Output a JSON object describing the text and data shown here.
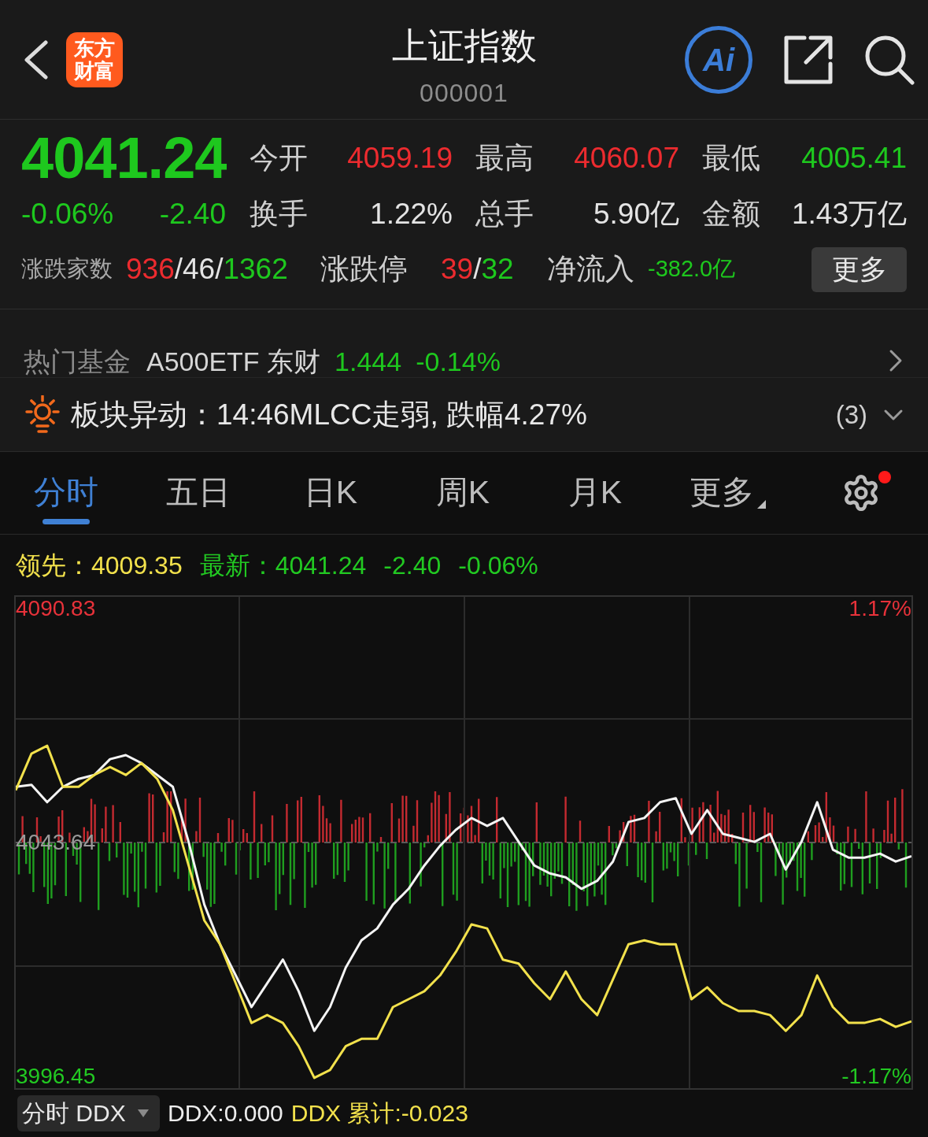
{
  "header": {
    "logo": "东方财富",
    "title": "上证指数",
    "code": "000001",
    "ai_label": "Ai"
  },
  "quote": {
    "price": "4041.24",
    "color": "#1ec81e",
    "change_pct": "-0.06%",
    "change": "-2.40",
    "stats": [
      {
        "label": "今开",
        "value": "4059.19",
        "color": "#ec2b2f"
      },
      {
        "label": "最高",
        "value": "4060.07",
        "color": "#ec2b2f"
      },
      {
        "label": "最低",
        "value": "4005.41",
        "color": "#1ec81e"
      },
      {
        "label": "换手",
        "value": "1.22%",
        "color": "#e4e4e4"
      },
      {
        "label": "总手",
        "value": "5.90亿",
        "color": "#e4e4e4"
      },
      {
        "label": "金额",
        "value": "1.43万亿",
        "color": "#e4e4e4"
      }
    ],
    "breadth": {
      "label": "涨跌家数",
      "parts": [
        {
          "text": "936",
          "color": "#ec2b2f"
        },
        {
          "text": "/46/",
          "color": "#e4e4e4"
        },
        {
          "text": "1362",
          "color": "#1ec81e"
        }
      ]
    },
    "limits": {
      "label": "涨跌停",
      "parts": [
        {
          "text": "39",
          "color": "#ec2b2f"
        },
        {
          "text": "/",
          "color": "#e4e4e4"
        },
        {
          "text": "32",
          "color": "#1ec81e"
        }
      ]
    },
    "net_inflow": {
      "label": "净流入",
      "value": "-382.0亿",
      "color": "#1ec81e"
    },
    "more_button": "更多"
  },
  "hot_fund": {
    "label": "热门基金",
    "name": "A500ETF 东财",
    "price": "1.444",
    "change": "-0.14%",
    "color": "#1ec81e"
  },
  "sector_alert": {
    "text": "板块异动：14:46MLCC走弱, 跌幅4.27%",
    "count": "(3)"
  },
  "tabs": [
    {
      "label": "分时",
      "selected": true,
      "kind": "tab"
    },
    {
      "label": "五日",
      "selected": false,
      "kind": "tab"
    },
    {
      "label": "日K",
      "selected": false,
      "kind": "tab"
    },
    {
      "label": "周K",
      "selected": false,
      "kind": "tab"
    },
    {
      "label": "月K",
      "selected": false,
      "kind": "tab"
    },
    {
      "label": "更多",
      "selected": false,
      "kind": "menu"
    }
  ],
  "settings": {
    "notification": true
  },
  "legend": [
    {
      "label": "领先：",
      "values": [
        "4009.35"
      ],
      "color": "#f2e14c"
    },
    {
      "label": "最新：",
      "values": [
        "4041.24",
        "-2.40",
        "-0.06%"
      ],
      "color": "#22c922"
    }
  ],
  "chart": {
    "chart_data": {
      "type": "line",
      "ylim": [
        3993.7,
        4093.6
      ],
      "yticks": [
        {
          "value": 4090.83,
          "label": "4090.83"
        },
        {
          "value": 4043.64,
          "label": "4043.64"
        },
        {
          "value": 3996.45,
          "label": "3996.45"
        }
      ],
      "series": [
        {
          "color": "#f4f4f4",
          "values": [
            4054.9,
            4055.3,
            4051.8,
            4054.9,
            4056.5,
            4057.3,
            4060.5,
            4061.3,
            4059.7,
            4057.3,
            4054.9,
            4043.8,
            4031.1,
            4023.1,
            4016.8,
            4010.4,
            4015.2,
            4020.0,
            4013.6,
            4005.6,
            4010.4,
            4018.4,
            4023.9,
            4026.3,
            4031.1,
            4034.3,
            4039.0,
            4043.0,
            4046.2,
            4048.6,
            4047.0,
            4048.6,
            4043.8,
            4039.0,
            4037.4,
            4036.6,
            4034.3,
            4035.9,
            4039.8,
            4047.8,
            4048.6,
            4051.8,
            4052.6,
            4045.4,
            4050.2,
            4045.4,
            4044.6,
            4043.8,
            4045.4,
            4038.2,
            4043.8,
            4051.8,
            4042.2,
            4040.6,
            4040.6,
            4041.4,
            4039.8,
            4040.9
          ]
        },
        {
          "color": "#f2e14c",
          "values": [
            4054.2,
            4061.6,
            4063.2,
            4054.9,
            4054.9,
            4057.3,
            4058.9,
            4057.3,
            4059.7,
            4056.5,
            4050.2,
            4039.0,
            4027.9,
            4023.1,
            4015.2,
            4007.2,
            4008.8,
            4007.2,
            4002.5,
            3996.1,
            3997.7,
            4002.5,
            4004.0,
            4004.0,
            4010.4,
            4012.0,
            4013.6,
            4016.8,
            4021.5,
            4027.1,
            4026.3,
            4020.0,
            4019.2,
            4015.2,
            4012.0,
            4017.6,
            4012.0,
            4008.8,
            4016.0,
            4023.1,
            4023.9,
            4023.1,
            4023.1,
            4012.0,
            4014.4,
            4011.2,
            4009.6,
            4009.6,
            4008.8,
            4005.6,
            4008.8,
            4016.8,
            4010.4,
            4007.2,
            4007.2,
            4008.0,
            4006.4,
            4007.5
          ]
        }
      ]
    },
    "right_axis": [
      "1.17%",
      "-1.17%"
    ]
  },
  "indicator": {
    "selector": "分时 DDX",
    "readings": [
      {
        "text": "DDX:0.000",
        "color": "#ececec"
      },
      {
        "text": "DDX 累计:-0.023",
        "color": "#f2e14c"
      }
    ]
  }
}
